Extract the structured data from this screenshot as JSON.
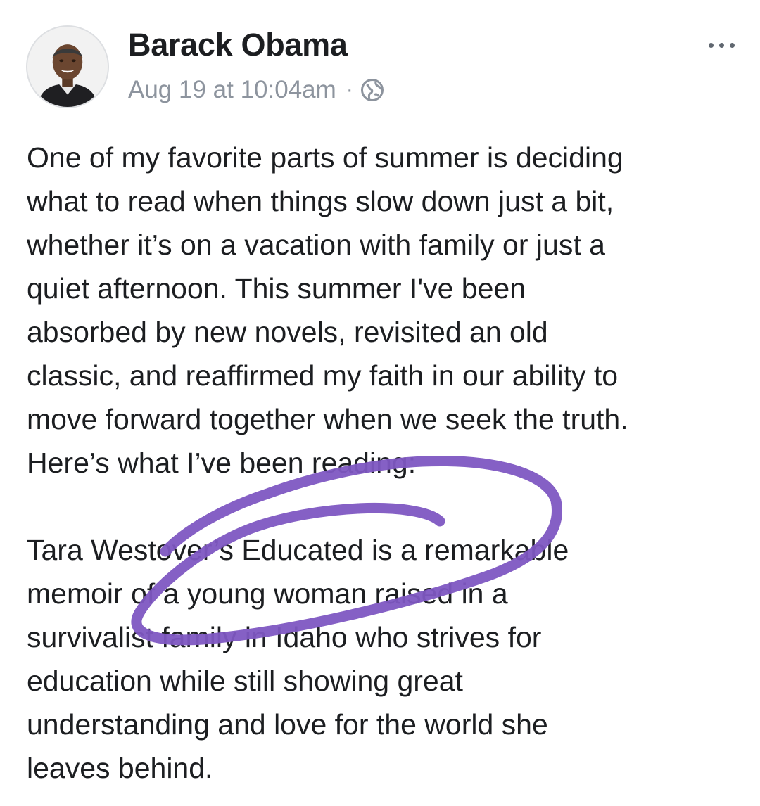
{
  "post": {
    "author": "Barack Obama",
    "timestamp": "Aug 19 at 10:04am",
    "separator": "·",
    "privacy_icon": "globe-icon",
    "more_icon": "more-horizontal-icon",
    "paragraphs": [
      "One of my favorite parts of summer is deciding\nwhat to read when things slow down just a bit,\nwhether it’s on a vacation with family or just a\nquiet afternoon. This summer I've been\nabsorbed by new novels, revisited an old\nclassic, and reaffirmed my faith in our ability to\nmove forward together when we seek the truth.\nHere’s what I’ve been reading:",
      "Tara Westover’s Educated is a remarkable\nmemoir of a young woman raised in a\nsurvivalist family in Idaho who strives for\neducation while still showing great\nunderstanding and love for the world she\nleaves behind."
    ]
  },
  "annotation": {
    "type": "hand-drawn-circle",
    "color": "#7e57c2"
  }
}
